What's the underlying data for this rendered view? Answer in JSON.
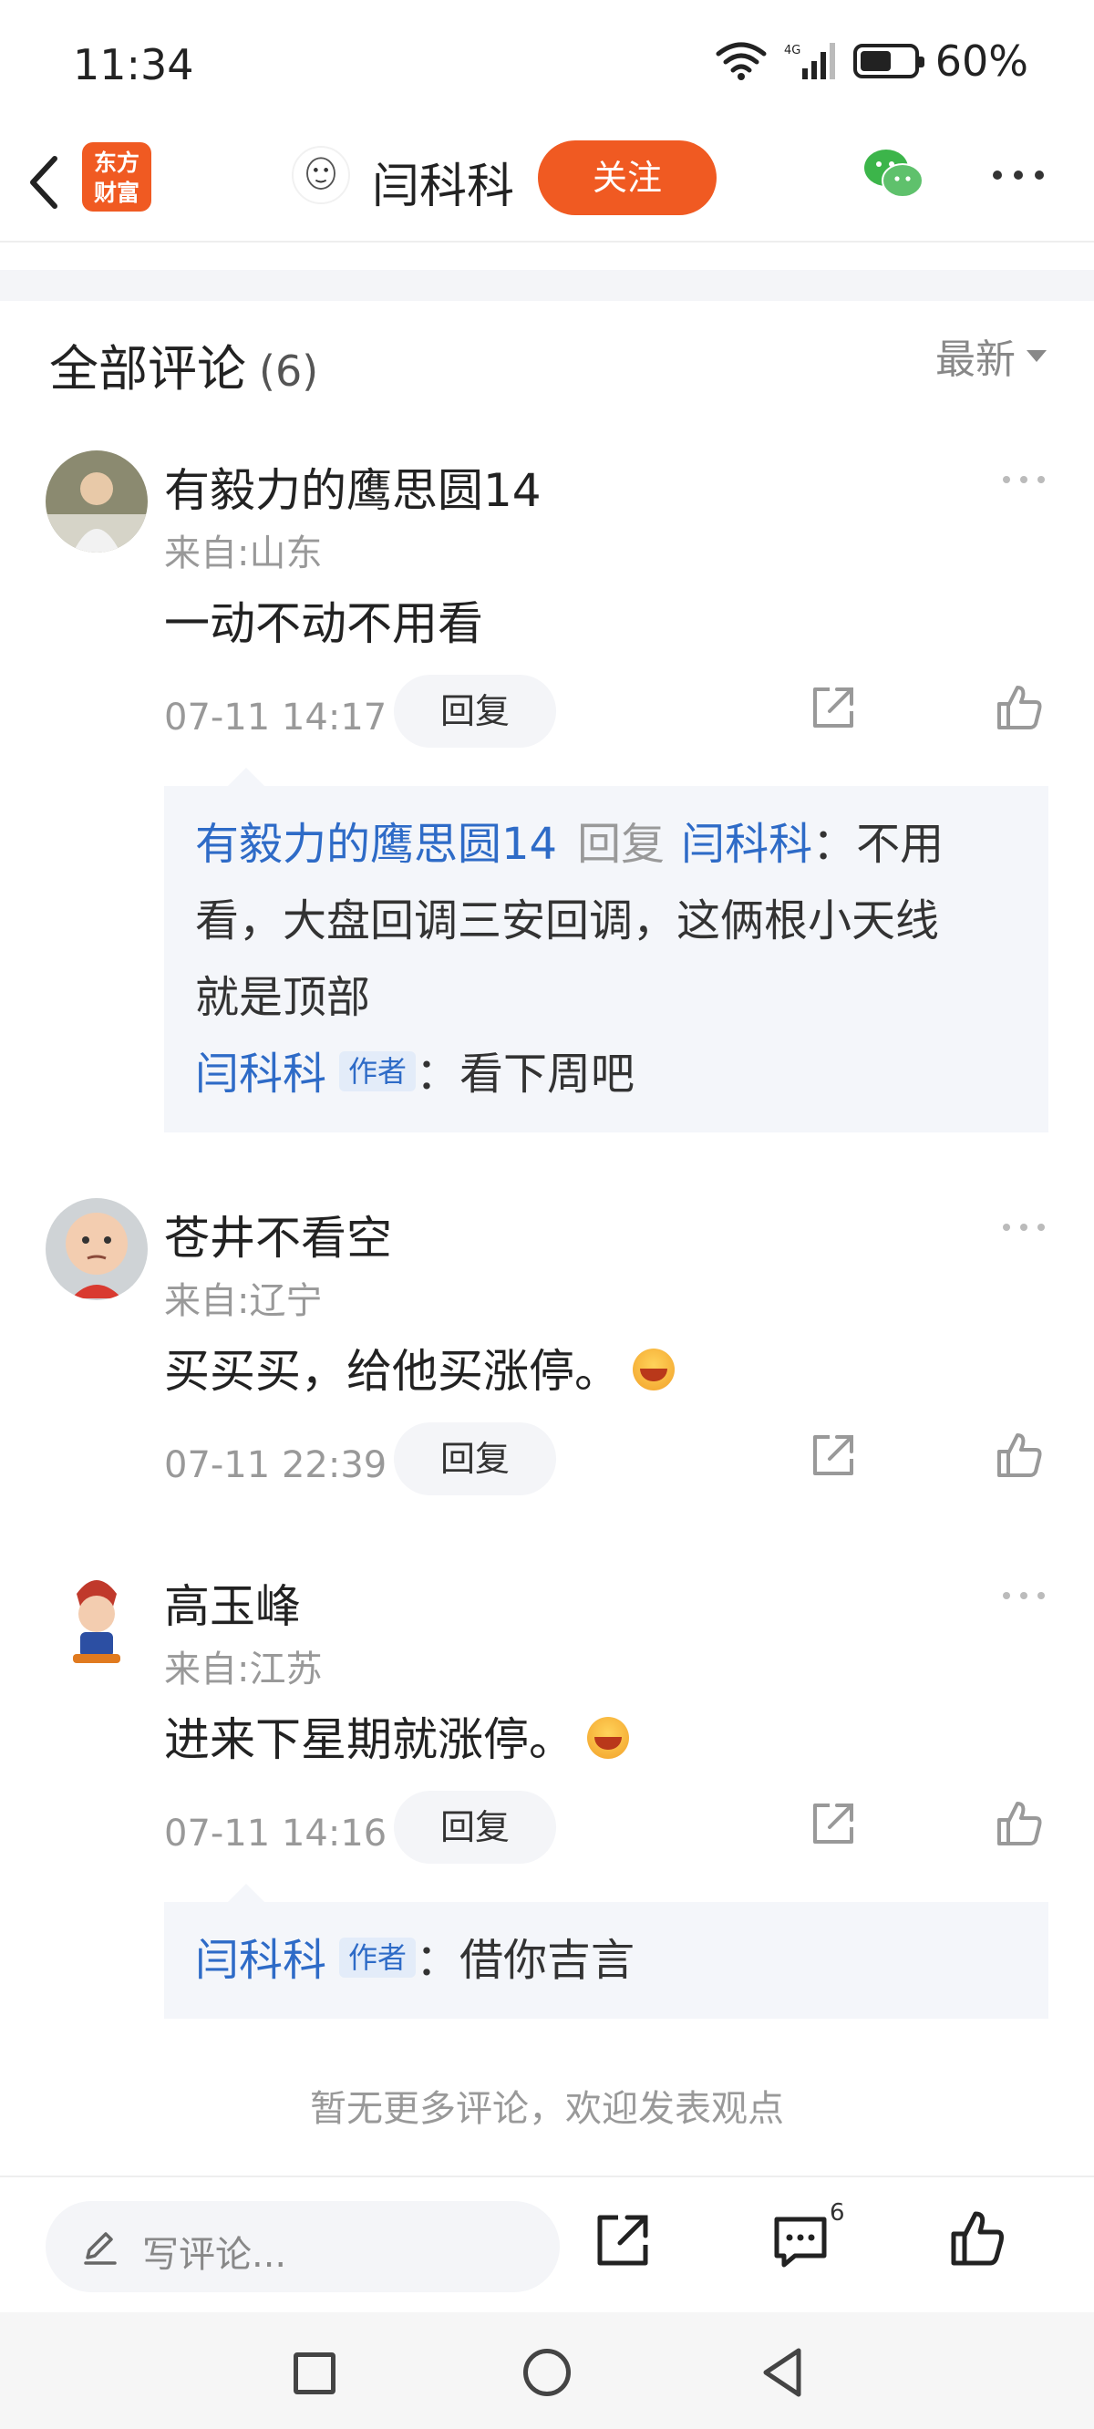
{
  "status_bar": {
    "time": "11:34",
    "battery": "60%",
    "battery_level": 0.6
  },
  "nav": {
    "app_logo_line1": "东方",
    "app_logo_line2": "财富",
    "author_name": "闫科科",
    "follow_label": "关注"
  },
  "header": {
    "title": "全部评论",
    "count": "(6)",
    "sort_label": "最新"
  },
  "comments": [
    {
      "name": "有毅力的鹰思圆14",
      "location": "来自:山东",
      "text": "一动不动不用看",
      "time": "07-11 14:17",
      "reply_label": "回复",
      "replies": {
        "r1_user": "有毅力的鹰思圆14",
        "r1_verb": "回复",
        "r1_target": "闫科科",
        "r1_text_line1": "：不用",
        "r1_text_line2": "看，大盘回调三安回调，这俩根小天线",
        "r1_text_line3": "就是顶部",
        "r2_user": "闫科科",
        "r2_tag": "作者",
        "r2_text": "：看下周吧"
      }
    },
    {
      "name": "苍井不看空",
      "location": "来自:辽宁",
      "text": "买买买，给他买涨停。",
      "time": "07-11 22:39",
      "reply_label": "回复"
    },
    {
      "name": "高玉峰",
      "location": "来自:江苏",
      "text": "进来下星期就涨停。",
      "time": "07-11 14:16",
      "reply_label": "回复",
      "replies": {
        "r1_user": "闫科科",
        "r1_tag": "作者",
        "r1_text": "：借你吉言"
      }
    }
  ],
  "no_more_text": "暂无更多评论，欢迎发表观点",
  "bottom_bar": {
    "input_placeholder": "写评论...",
    "comment_count": "6"
  },
  "colors": {
    "accent": "#f05a22",
    "link_blue": "#2e6bc7",
    "reply_bg": "#f4f6fa"
  }
}
